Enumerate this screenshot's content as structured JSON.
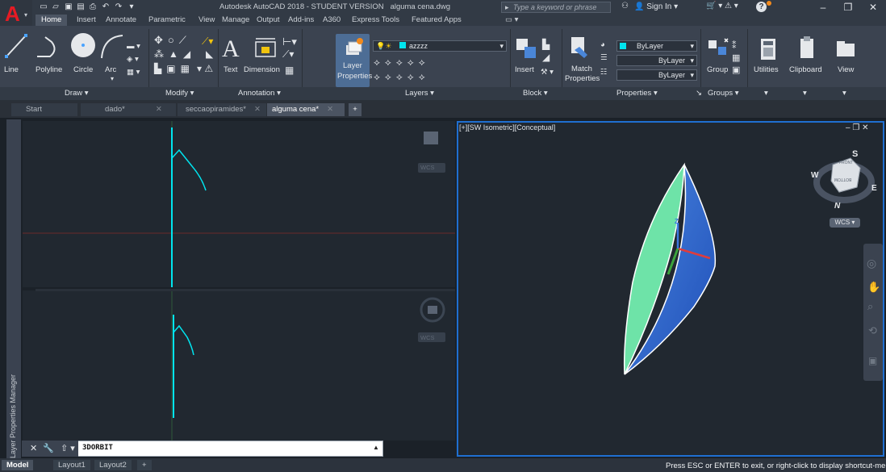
{
  "app": {
    "title": "Autodesk AutoCAD 2018 - STUDENT VERSION",
    "file": "alguma cena.dwg",
    "search_placeholder": "Type a keyword or phrase",
    "sign_in": "Sign In"
  },
  "ribbon_tabs": [
    "Home",
    "Insert",
    "Annotate",
    "Parametric",
    "View",
    "Manage",
    "Output",
    "Add-ins",
    "A360",
    "Express Tools",
    "Featured Apps"
  ],
  "ribbon": {
    "draw": {
      "line": "Line",
      "polyline": "Polyline",
      "circle": "Circle",
      "arc": "Arc",
      "title": "Draw"
    },
    "modify": {
      "title": "Modify"
    },
    "annotation": {
      "text": "Text",
      "dimension": "Dimension",
      "title": "Annotation"
    },
    "layers": {
      "layer_properties_1": "Layer",
      "layer_properties_2": "Properties",
      "current_layer": "azzzz",
      "title": "Layers"
    },
    "block": {
      "insert": "Insert",
      "title": "Block"
    },
    "properties": {
      "match_1": "Match",
      "match_2": "Properties",
      "color": "ByLayer",
      "linetype": "ByLayer",
      "lineweight": "ByLayer",
      "title": "Properties"
    },
    "groups": {
      "group": "Group",
      "title": "Groups"
    },
    "utilities": "Utilities",
    "clipboard": "Clipboard",
    "view": "View"
  },
  "file_tabs": [
    {
      "label": "Start"
    },
    {
      "label": "dado*"
    },
    {
      "label": "seccaopiramides*"
    },
    {
      "label": "alguma cena*"
    }
  ],
  "viewports": {
    "right_label": "[+][SW Isometric][Conceptual]",
    "wcs": "WCS",
    "viewcube_top": "FRONT",
    "viewcube_bottom": "BOTTOM",
    "compass": {
      "n": "N",
      "s": "S",
      "e": "E",
      "w": "W"
    }
  },
  "side_panel": "Layer Properties Manager",
  "command": {
    "text": "3DORBIT"
  },
  "layout_tabs": [
    "Model",
    "Layout1",
    "Layout2"
  ],
  "status": "Press ESC or ENTER to exit, or right-click to display shortcut-menu.",
  "colors": {
    "accent": "#1f6fd1",
    "cyan": "#00e5ef",
    "autocad_red": "#e51b24"
  }
}
